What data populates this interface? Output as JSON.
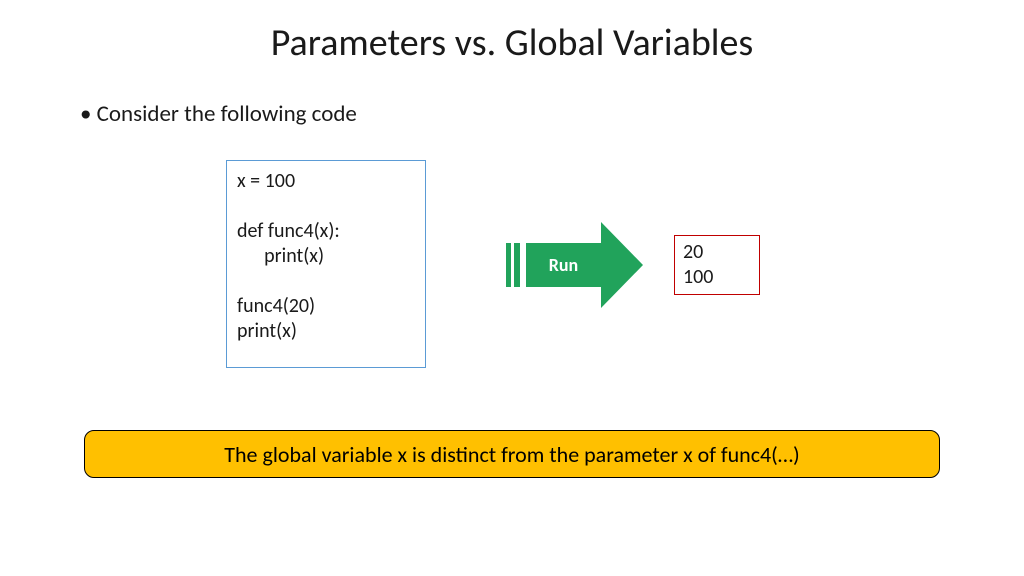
{
  "slide": {
    "title": "Parameters vs. Global Variables",
    "bullet": "Consider the following code",
    "code": "x = 100\n\ndef func4(x):\n      print(x)\n\nfunc4(20)\nprint(x)",
    "arrow_label": "Run",
    "output": "20\n100",
    "banner": "The global variable x is distinct from the parameter x of func4(…)"
  }
}
